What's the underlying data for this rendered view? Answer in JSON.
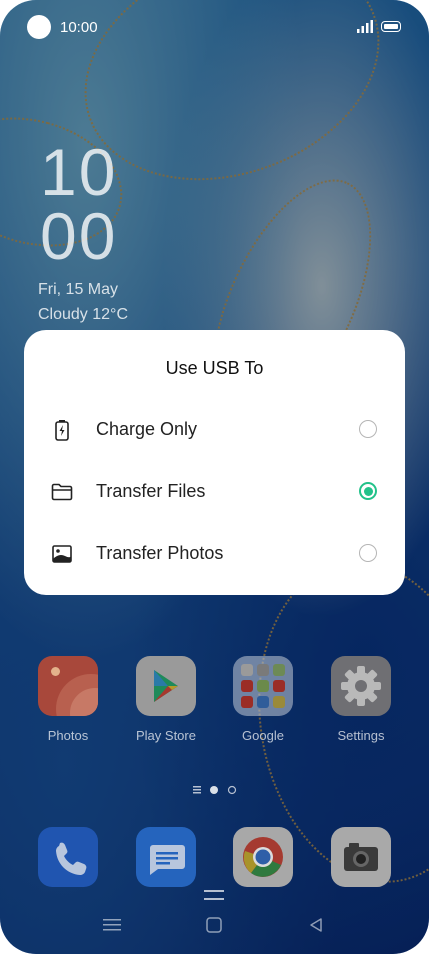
{
  "status_bar": {
    "time": "10:00"
  },
  "lock": {
    "hour": "10",
    "minute": "00",
    "date": "Fri, 15 May",
    "weather": "Cloudy 12°C"
  },
  "dialog": {
    "title": "Use USB To",
    "options": [
      {
        "label": "Charge Only",
        "icon": "battery-charging-icon",
        "selected": false
      },
      {
        "label": "Transfer Files",
        "icon": "folder-icon",
        "selected": true
      },
      {
        "label": "Transfer Photos",
        "icon": "photo-icon",
        "selected": false
      }
    ]
  },
  "home": {
    "apps": [
      {
        "label": "Photos",
        "icon": "photos-icon"
      },
      {
        "label": "Play Store",
        "icon": "play-store-icon"
      },
      {
        "label": "Google",
        "icon": "google-folder-icon"
      },
      {
        "label": "Settings",
        "icon": "settings-gear-icon"
      }
    ],
    "dock": [
      {
        "icon": "phone-icon"
      },
      {
        "icon": "messages-icon"
      },
      {
        "icon": "chrome-icon"
      },
      {
        "icon": "camera-icon"
      }
    ]
  },
  "colors": {
    "accent": "#22c28a",
    "dialog_bg": "#ffffff"
  }
}
